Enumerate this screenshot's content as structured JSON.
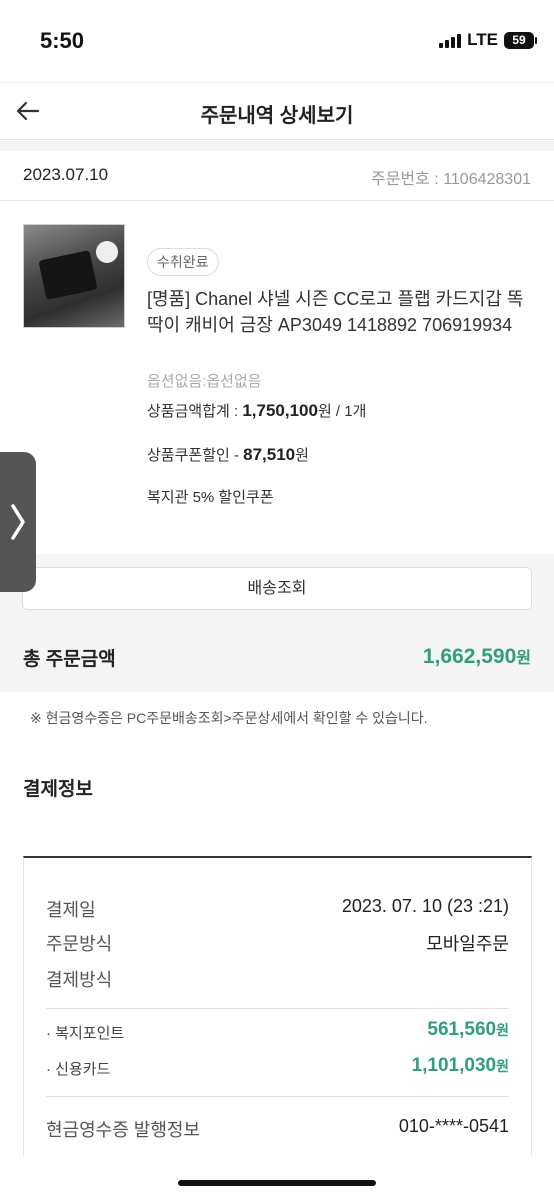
{
  "status_bar": {
    "time": "5:50",
    "network": "LTE",
    "battery": "59"
  },
  "header": {
    "title": "주문내역 상세보기",
    "back_icon": "arrow-left-icon"
  },
  "order": {
    "date": "2023.07.10",
    "order_number": "주문번호 : 1106428301"
  },
  "product": {
    "status_badge": "수취완료",
    "name": "[명품] Chanel 샤넬 시즌 CC로고 플랩 카드지갑 똑딱이 캐비어 금장 AP3049 1418892 706919934",
    "option": "옵션없음:옵션없음",
    "price_label": "상품금액합계 : ",
    "price_value": "1,750,100",
    "price_suffix": "원 / 1개",
    "coupon_label": "상품쿠폰할인 - ",
    "coupon_value": "87,510",
    "coupon_suffix": "원",
    "coupon_name": "복지관 5% 할인쿠폰"
  },
  "side_tab": {
    "icon": "chevron-right-icon"
  },
  "shipping": {
    "button_label": "배송조회"
  },
  "total": {
    "label": "총 주문금액",
    "value": "1,662,590",
    "unit": "원"
  },
  "notice": "※ 현금영수증은 PC주문배송조회>주문상세에서 확인할 수 있습니다.",
  "payment": {
    "title": "결제정보",
    "date_label": "결제일",
    "date_value": "2023. 07. 10 (23 :21)",
    "method_label": "주문방식",
    "method_value": "모바일주문",
    "pay_method_label": "결제방식",
    "items": [
      {
        "label": "· 복지포인트",
        "value": "561,560",
        "unit": "원"
      },
      {
        "label": "· 신용카드",
        "value": "1,101,030",
        "unit": "원"
      }
    ],
    "receipt_label": "현금영수증 발행정보",
    "receipt_value": "010-****-0541"
  },
  "colors": {
    "accent": "#2f9e7e",
    "side_tab": "#555555"
  }
}
